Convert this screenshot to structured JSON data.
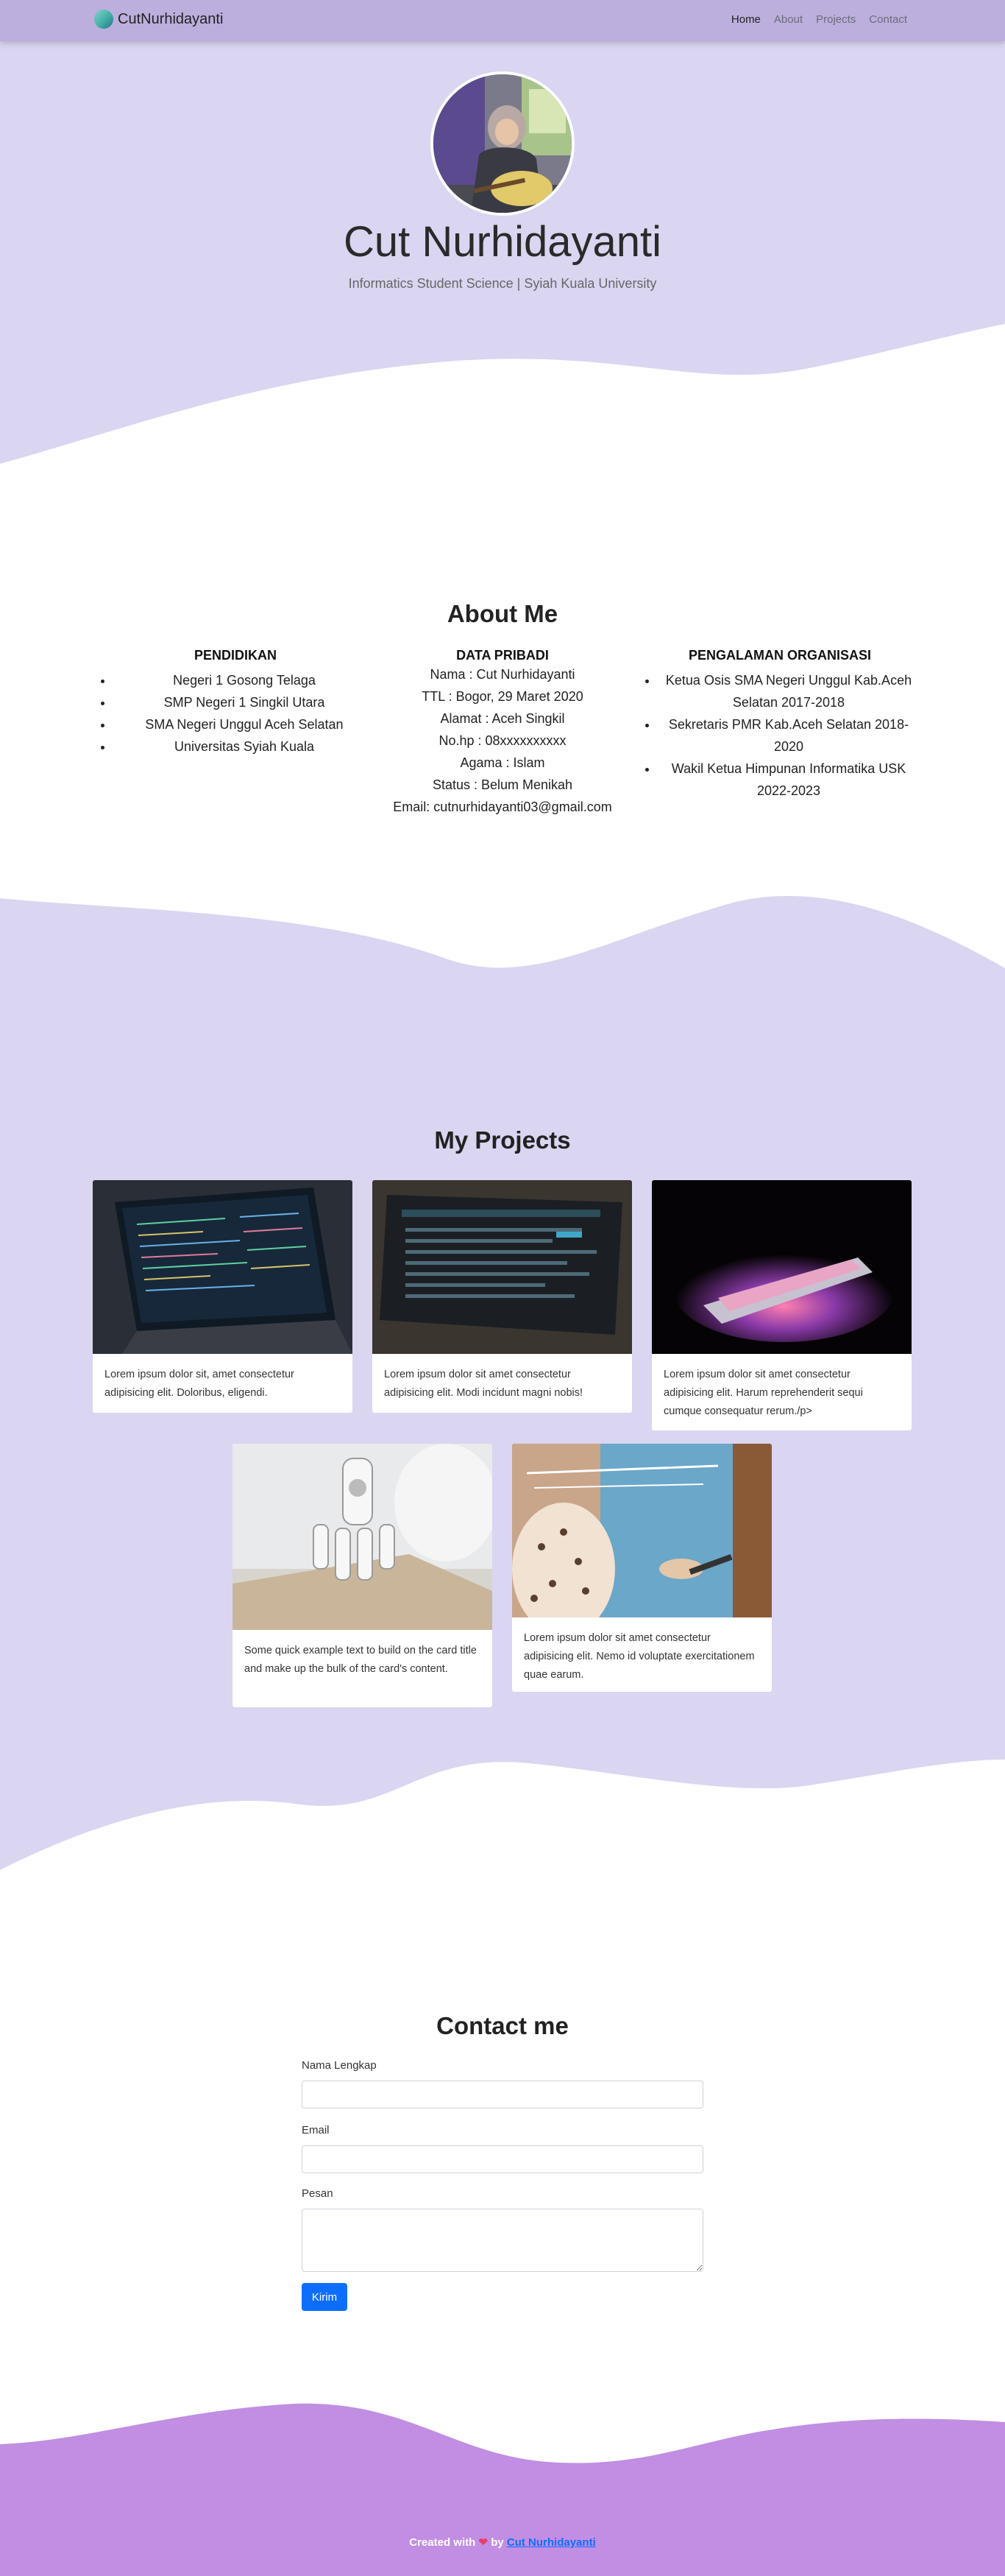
{
  "navbar": {
    "brand": "CutNurhidayanti",
    "links": [
      "Home",
      "About",
      "Projects",
      "Contact"
    ]
  },
  "hero": {
    "name": "Cut Nurhidayanti",
    "subtitle": "Informatics Student Science | Syiah Kuala University"
  },
  "about": {
    "title": "About Me",
    "pendidikan": {
      "heading": "PENDIDIKAN",
      "items": [
        "Negeri 1 Gosong Telaga",
        "SMP Negeri 1 Singkil Utara",
        "SMA Negeri Unggul Aceh Selatan",
        "Universitas Syiah Kuala"
      ]
    },
    "data_pribadi": {
      "heading": "DATA PRIBADI",
      "lines": [
        "Nama : Cut Nurhidayanti",
        "TTL : Bogor, 29 Maret 2020",
        "Alamat : Aceh Singkil",
        "No.hp : 08xxxxxxxxxx",
        "Agama : Islam",
        "Status : Belum Menikah",
        "Email: cutnurhidayanti03@gmail.com"
      ]
    },
    "organisasi": {
      "heading": "PENGALAMAN ORGANISASI",
      "items": [
        "Ketua Osis SMA Negeri Unggul Kab.Aceh Selatan 2017-2018",
        "Sekretaris PMR Kab.Aceh Selatan 2018-2020",
        "Wakil Ketua Himpunan Informatika USK 2022-2023"
      ]
    }
  },
  "projects": {
    "title": "My Projects",
    "cards": [
      {
        "text": "Lorem ipsum dolor sit, amet consectetur adipisicing elit. Doloribus, eligendi.",
        "image": "laptop-code-image"
      },
      {
        "text": "Lorem ipsum dolor sit amet consectetur adipisicing elit. Modi incidunt magni nobis!",
        "image": "terminal-screen-image"
      },
      {
        "text": "Lorem ipsum dolor sit amet consectetur adipisicing elit. Harum reprehenderit sequi cumque consequatur rerum./p>",
        "image": "glowing-laptop-image"
      },
      {
        "text": "Some quick example text to build on the card title and make up the bulk of the card's content.",
        "image": "robot-hand-image"
      },
      {
        "text": "Lorem ipsum dolor sit amet consectetur adipisicing elit. Nemo id voluptate exercitationem quae earum.",
        "image": "person-writing-glass-image"
      }
    ]
  },
  "contact": {
    "title": "Contact me",
    "name_label": "Nama Lengkap",
    "email_label": "Email",
    "message_label": "Pesan",
    "submit_label": "Kirim"
  },
  "footer": {
    "prefix": "Created with",
    "by": "by",
    "author": "Cut Nurhidayanti"
  },
  "colors": {
    "navbar": "#bcaedd",
    "lavender": "#dad5f1",
    "footer": "#c18ee3",
    "button": "#0d6efd"
  }
}
